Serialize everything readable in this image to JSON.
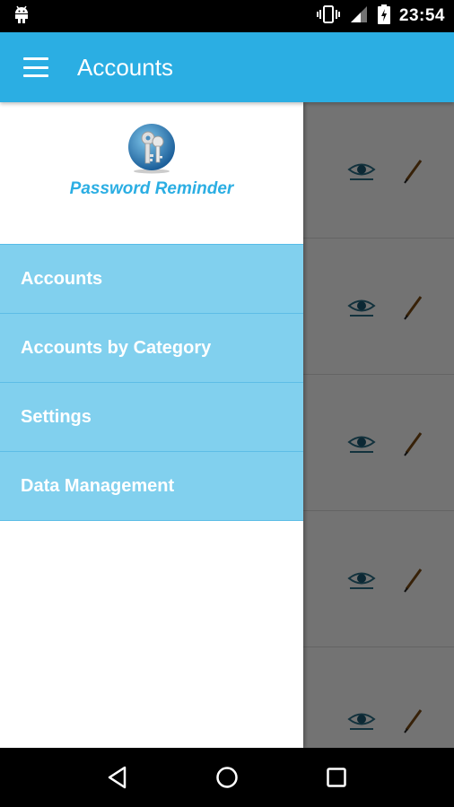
{
  "status_bar": {
    "time": "23:54",
    "icons": [
      "android-icon",
      "vibrate-icon",
      "signal-icon",
      "battery-charging-icon"
    ]
  },
  "app_bar": {
    "title": "Accounts",
    "menu_icon": "hamburger-menu-icon",
    "color": "#2BAEE3"
  },
  "drawer": {
    "app_name": "Password Reminder",
    "logo_icon": "keys-globe-icon",
    "items": [
      {
        "label": "Accounts"
      },
      {
        "label": "Accounts by Category"
      },
      {
        "label": "Settings"
      },
      {
        "label": "Data Management"
      }
    ],
    "item_color": "#81D0EE"
  },
  "content": {
    "row_actions": [
      "view-eye-icon",
      "edit-pencil-icon"
    ],
    "row_count": 5
  },
  "nav_bar": {
    "buttons": [
      "back-icon",
      "home-icon",
      "recents-icon"
    ]
  }
}
